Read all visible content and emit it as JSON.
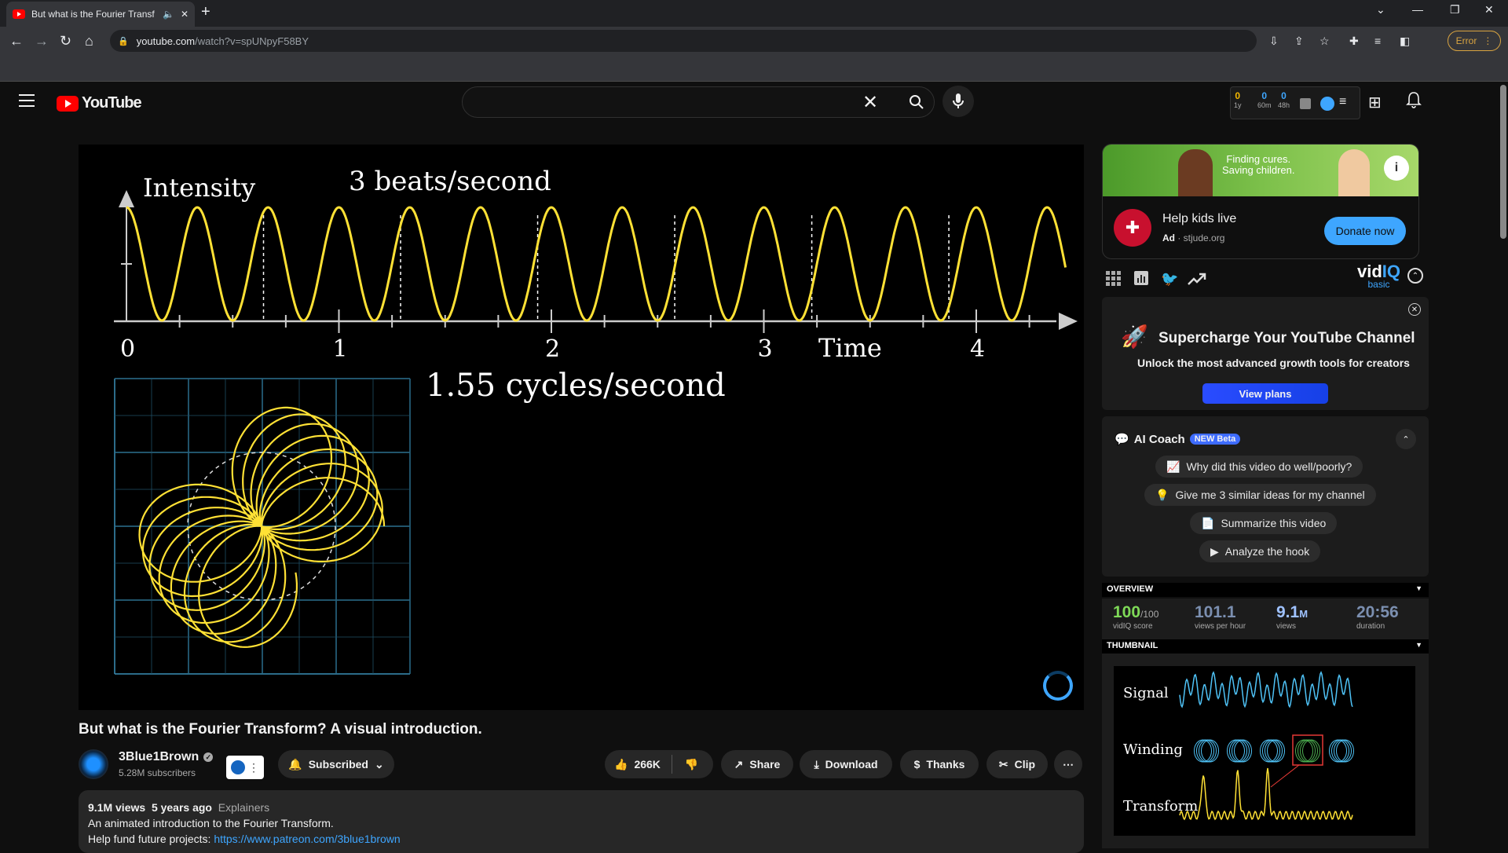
{
  "browser": {
    "tab_title": "But what is the Fourier Transf",
    "url_host": "youtube.com",
    "url_path": "/watch?v=spUNpyF58BY",
    "error_label": "Error"
  },
  "header": {
    "logo_text": "YouTube",
    "search_value": ""
  },
  "vidiq_stats": [
    {
      "value": "0",
      "label": "1y"
    },
    {
      "value": "0",
      "label": "60m"
    },
    {
      "value": "0",
      "label": "48h"
    }
  ],
  "video": {
    "intensity_label": "Intensity",
    "beats_label": "3 beats/second",
    "time_label": "Time",
    "axis_ticks": [
      "0",
      "1",
      "2",
      "3",
      "4"
    ],
    "cycles_label": "1.55  cycles/second"
  },
  "info": {
    "title": "But what is the Fourier Transform? A visual introduction.",
    "channel_name": "3Blue1Brown",
    "subscribers": "5.28M subscribers",
    "subscribed_label": "Subscribed",
    "likes": "266K",
    "share_label": "Share",
    "download_label": "Download",
    "thanks_label": "Thanks",
    "clip_label": "Clip",
    "views": "9.1M views",
    "age": "5 years ago",
    "tag": "Explainers",
    "desc_line1": "An animated introduction to the Fourier Transform.",
    "desc_line2_prefix": "Help fund future projects: ",
    "desc_link": "https://www.patreon.com/3blue1brown"
  },
  "ad": {
    "banner_line1": "Finding cures.",
    "banner_line2": "Saving children.",
    "title": "Help kids live",
    "ad_label": "Ad",
    "domain": "stjude.org",
    "cta": "Donate now"
  },
  "vidiq": {
    "logo_a": "vid",
    "logo_b": "IQ",
    "plan": "basic",
    "promo_title": "Supercharge Your YouTube Channel",
    "promo_sub": "Unlock the most advanced growth tools for creators",
    "promo_btn": "View plans",
    "coach_title": "AI Coach",
    "coach_badge": "NEW Beta",
    "suggestions": [
      "Why did this video do well/poorly?",
      "Give me 3 similar ideas for my channel",
      "Summarize this video",
      "Analyze the hook"
    ],
    "overview_header": "OVERVIEW",
    "score": "100",
    "score_max": "/100",
    "score_label": "vidIQ score",
    "vph": "101.1",
    "vph_label": "views per hour",
    "views_num": "9.1",
    "views_unit": "M",
    "views_label": "views",
    "duration": "20:56",
    "duration_label": "duration",
    "thumbnail_header": "THUMBNAIL",
    "thumb_signal": "Signal",
    "thumb_winding": "Winding",
    "thumb_transform": "Transform"
  },
  "colors": {
    "accent": "#3ea6ff",
    "yt_red": "#ff0000",
    "curve_yellow": "#ffe135",
    "grid_blue": "#3a8fb7"
  }
}
